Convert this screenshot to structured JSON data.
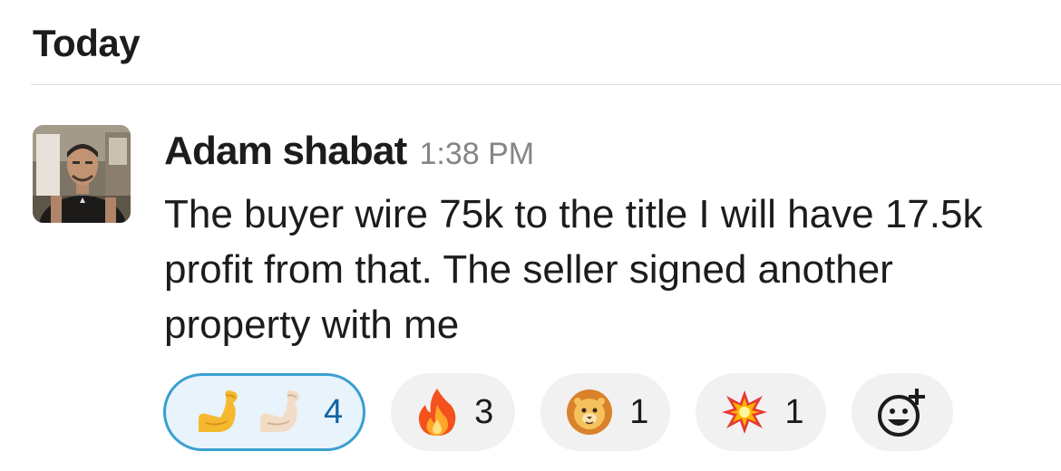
{
  "day_header": "Today",
  "message": {
    "author": "Adam shabat",
    "time": "1:38 PM",
    "text": "The buyer wire 75k to the title I will have 17.5k profit from that. The seller signed another property with me"
  },
  "reactions": [
    {
      "emoji": "flexed-biceps (two skin tones)",
      "count": "4",
      "selected": true
    },
    {
      "emoji": "fire",
      "count": "3",
      "selected": false
    },
    {
      "emoji": "lion-face",
      "count": "1",
      "selected": false
    },
    {
      "emoji": "collision",
      "count": "1",
      "selected": false
    }
  ],
  "add_reaction_icon": "add-emoji-icon",
  "colors": {
    "selected_border": "#3a9fd1",
    "selected_background": "#e8f3fb",
    "pill_background": "#f1f1f1",
    "timestamp": "#858585"
  }
}
